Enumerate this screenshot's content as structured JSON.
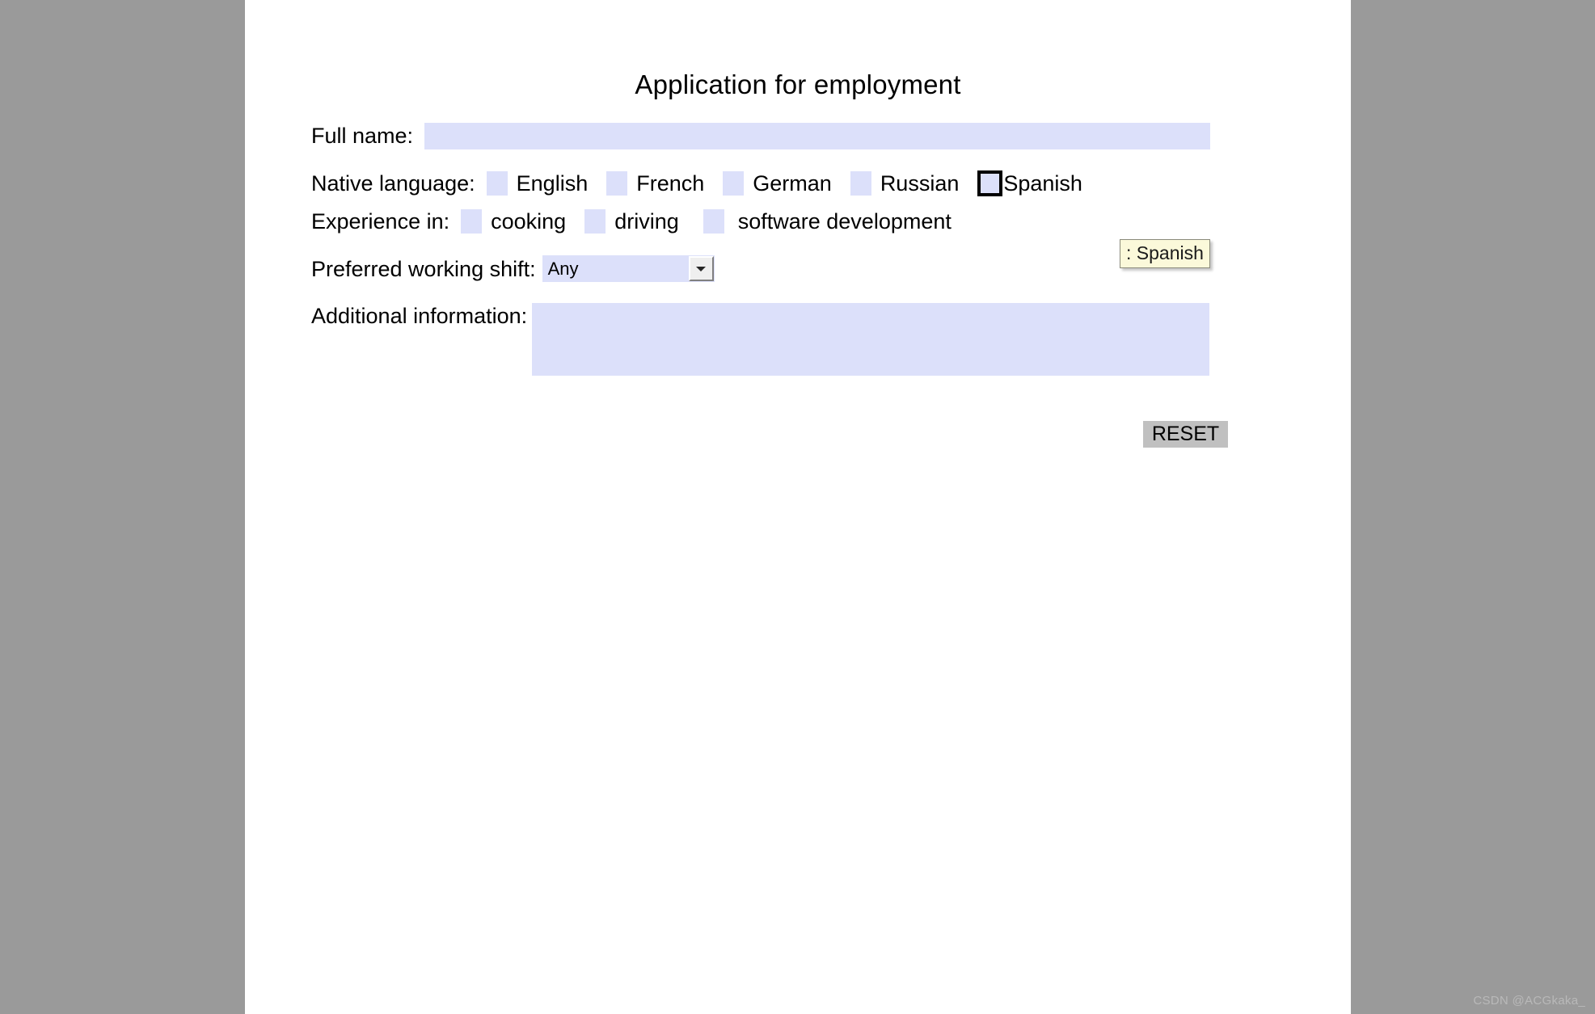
{
  "page": {
    "title": "Application for employment",
    "background_color": "#9a9a9a",
    "sheet_color": "#ffffff",
    "field_color": "#dce0fa"
  },
  "form": {
    "fullname": {
      "label": "Full name:",
      "value": "",
      "placeholder": ""
    },
    "native_language": {
      "label": "Native language:",
      "options": [
        {
          "label": "English",
          "checked": false,
          "focused": false
        },
        {
          "label": "French",
          "checked": false,
          "focused": false
        },
        {
          "label": "German",
          "checked": false,
          "focused": false
        },
        {
          "label": "Russian",
          "checked": false,
          "focused": false
        },
        {
          "label": "Spanish",
          "checked": false,
          "focused": true
        }
      ]
    },
    "experience": {
      "label": "Experience in:",
      "options": [
        {
          "label": "cooking",
          "checked": false
        },
        {
          "label": "driving",
          "checked": false
        },
        {
          "label": "software development",
          "checked": false
        }
      ]
    },
    "shift": {
      "label": "Preferred working shift:",
      "selected": "Any",
      "options": [
        "Any"
      ]
    },
    "additional": {
      "label": "Additional information:",
      "value": "",
      "placeholder": ""
    },
    "reset": {
      "label": "RESET"
    }
  },
  "tooltip": {
    "text": ": Spanish",
    "background_color": "#fbf9da"
  },
  "watermark": {
    "text": "CSDN @ACGkaka_"
  }
}
